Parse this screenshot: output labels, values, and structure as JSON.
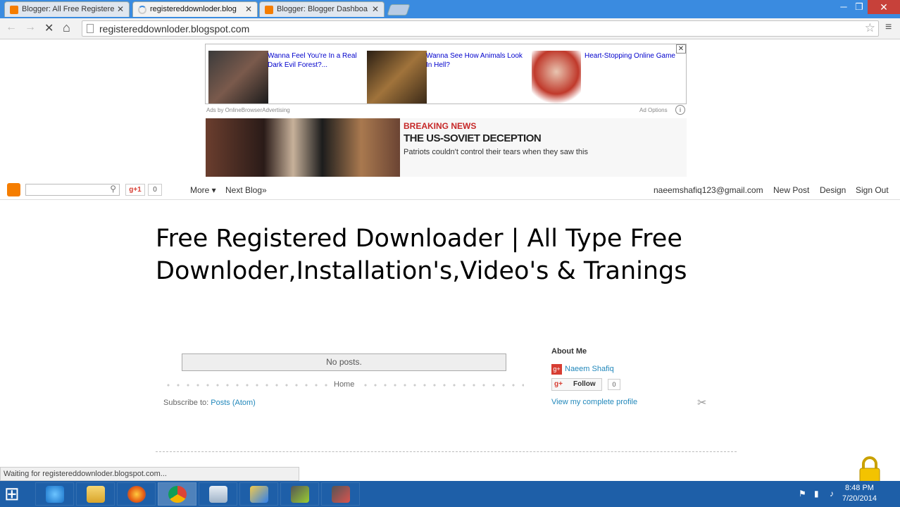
{
  "tabs": [
    {
      "label": "Blogger: All Free Registere",
      "active": false
    },
    {
      "label": "registereddownloder.blog",
      "active": true
    },
    {
      "label": "Blogger: Blogger Dashboa",
      "active": false
    }
  ],
  "window": {
    "minimize": "─",
    "restore": "❐",
    "close": "✕"
  },
  "toolbar": {
    "back": "←",
    "forward": "→",
    "stop": "✕",
    "home": "⌂",
    "url": "registereddownloder.blogspot.com",
    "bookmark": "☆",
    "menu": "≡"
  },
  "ads": {
    "items": [
      "Wanna Feel You're In a Real Dark Evil Forest?...",
      "Wanna See How Animals Look In Hell?",
      "Heart-Stopping Online Game"
    ],
    "close": "✕",
    "by": "Ads by OnlineBrowserAdvertising",
    "options": "Ad Options",
    "info": "i"
  },
  "news": {
    "tag": "BREAKING NEWS",
    "headline": "THE US-SOVIET DECEPTION",
    "text": "Patriots couldn't control their tears when they saw this"
  },
  "navbar": {
    "search_icon": "⚲",
    "gplus": "g+1",
    "gplus_count": "0",
    "more": "More ▾",
    "next_blog": "Next Blog»",
    "email": "naeemshafiq123@gmail.com",
    "new_post": "New Post",
    "design": "Design",
    "sign_out": "Sign Out"
  },
  "blog": {
    "title": "Free Registered Downloader | All Type Free Downloder,Installation's,Video's & Tranings",
    "no_posts": "No posts.",
    "home": "Home",
    "subscribe_prefix": "Subscribe to: ",
    "subscribe_link": "Posts (Atom)",
    "about_title": "About Me",
    "gplus_icon": "g+",
    "profile_name": "Naeem Shafiq",
    "follow": "Follow",
    "follow_count": "0",
    "view_profile": "View my complete profile",
    "tools": "✂"
  },
  "status": "Waiting for registereddownloder.blogspot.com...",
  "taskbar": {
    "start": "⊞",
    "time": "8:48 PM",
    "date": "7/20/2014"
  },
  "colors": {
    "blogger_orange": "#f57d00",
    "link": "#2288bb",
    "chrome_blue": "#3a8be0",
    "taskbar": "#1e5fa8"
  }
}
